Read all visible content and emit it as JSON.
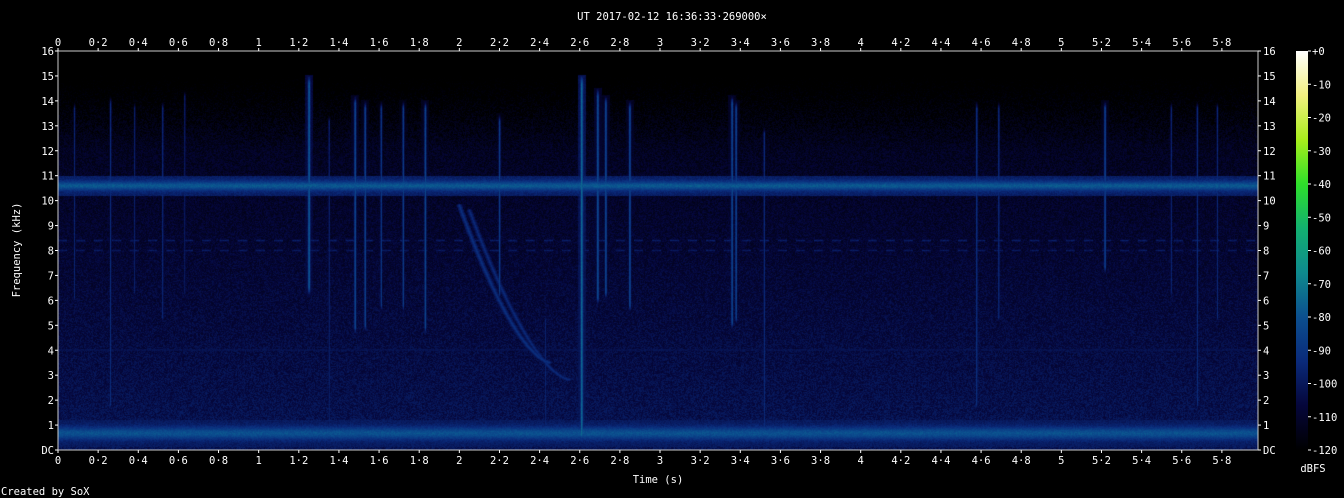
{
  "chart_data": {
    "type": "heatmap",
    "title": "UT 2017-02-12 16:36:33·269000×",
    "xlabel": "Time (s)",
    "ylabel": "Frequency (kHz)",
    "footer": "Created by SoX",
    "xlim": [
      0,
      5.98
    ],
    "ylim": [
      0,
      16
    ],
    "x_ticks": [
      "0",
      "0·2",
      "0·4",
      "0·6",
      "0·8",
      "1",
      "1·2",
      "1·4",
      "1·6",
      "1·8",
      "2",
      "2·2",
      "2·4",
      "2·6",
      "2·8",
      "3",
      "3·2",
      "3·4",
      "3·6",
      "3·8",
      "4",
      "4·2",
      "4·4",
      "4·6",
      "4·8",
      "5",
      "5·2",
      "5·4",
      "5·6",
      "5·8"
    ],
    "y_ticks": [
      "DC",
      "1",
      "2",
      "3",
      "4",
      "5",
      "6",
      "7",
      "8",
      "9",
      "10",
      "11",
      "12",
      "13",
      "14",
      "15",
      "16"
    ],
    "colorbar": {
      "label": "dBFS",
      "ticks": [
        "+0",
        "-10",
        "-20",
        "-30",
        "-40",
        "-50",
        "-60",
        "-70",
        "-80",
        "-90",
        "-100",
        "-110",
        "-120"
      ],
      "range": [
        -120,
        0
      ],
      "colors": [
        "#000000",
        "#05063a",
        "#0a2a7a",
        "#0b4f8f",
        "#0e8a8e",
        "#12b070",
        "#2ee02a",
        "#a8ee1c",
        "#f2f080",
        "#ffffff"
      ]
    },
    "background_level_dbfs": -105,
    "bands": [
      {
        "name": "tone",
        "freq_khz": 10.6,
        "width_khz": 0.35,
        "level_dbfs": -78
      },
      {
        "name": "low-band",
        "freq_khz": 0.65,
        "width_khz": 0.5,
        "level_dbfs": -80
      },
      {
        "name": "dashed",
        "freq_khz": 8.4,
        "width_khz": 0.12,
        "level_dbfs": -98
      },
      {
        "name": "dashed",
        "freq_khz": 8.0,
        "width_khz": 0.12,
        "level_dbfs": -99
      },
      {
        "name": "hum",
        "freq_khz": 4.0,
        "width_khz": 0.1,
        "level_dbfs": -100
      }
    ],
    "impulses": [
      {
        "t": 0.08,
        "f_min": 5.8,
        "f_max": 14.0,
        "level_dbfs": -95
      },
      {
        "t": 0.26,
        "f_min": 1.5,
        "f_max": 14.2,
        "level_dbfs": -92
      },
      {
        "t": 0.38,
        "f_min": 6.0,
        "f_max": 14.0,
        "level_dbfs": -96
      },
      {
        "t": 0.52,
        "f_min": 5.0,
        "f_max": 14.0,
        "level_dbfs": -93
      },
      {
        "t": 0.63,
        "f_min": 6.0,
        "f_max": 14.5,
        "level_dbfs": -97
      },
      {
        "t": 1.25,
        "f_min": 6.2,
        "f_max": 15.0,
        "level_dbfs": -76
      },
      {
        "t": 1.35,
        "f_min": 0.5,
        "f_max": 13.5,
        "level_dbfs": -95
      },
      {
        "t": 1.48,
        "f_min": 4.6,
        "f_max": 14.2,
        "level_dbfs": -82
      },
      {
        "t": 1.53,
        "f_min": 4.7,
        "f_max": 14.0,
        "level_dbfs": -84
      },
      {
        "t": 1.61,
        "f_min": 5.5,
        "f_max": 14.0,
        "level_dbfs": -88
      },
      {
        "t": 1.72,
        "f_min": 5.5,
        "f_max": 14.0,
        "level_dbfs": -86
      },
      {
        "t": 1.83,
        "f_min": 4.6,
        "f_max": 14.0,
        "level_dbfs": -83
      },
      {
        "t": 2.2,
        "f_min": 6.0,
        "f_max": 13.5,
        "level_dbfs": -86
      },
      {
        "t": 2.43,
        "f_min": 0.5,
        "f_max": 5.5,
        "level_dbfs": -95
      },
      {
        "t": 2.61,
        "f_min": 0.3,
        "f_max": 15.0,
        "level_dbfs": -72
      },
      {
        "t": 2.69,
        "f_min": 5.8,
        "f_max": 14.5,
        "level_dbfs": -80
      },
      {
        "t": 2.73,
        "f_min": 6.0,
        "f_max": 14.2,
        "level_dbfs": -82
      },
      {
        "t": 2.85,
        "f_min": 5.5,
        "f_max": 14.0,
        "level_dbfs": -82
      },
      {
        "t": 3.36,
        "f_min": 4.8,
        "f_max": 14.2,
        "level_dbfs": -82
      },
      {
        "t": 3.38,
        "f_min": 5.0,
        "f_max": 14.0,
        "level_dbfs": -84
      },
      {
        "t": 3.52,
        "f_min": 0.5,
        "f_max": 13.0,
        "level_dbfs": -92
      },
      {
        "t": 4.58,
        "f_min": 1.5,
        "f_max": 14.0,
        "level_dbfs": -90
      },
      {
        "t": 4.69,
        "f_min": 5.0,
        "f_max": 14.0,
        "level_dbfs": -92
      },
      {
        "t": 5.22,
        "f_min": 7.0,
        "f_max": 14.0,
        "level_dbfs": -84
      },
      {
        "t": 5.55,
        "f_min": 6.0,
        "f_max": 14.0,
        "level_dbfs": -94
      },
      {
        "t": 5.68,
        "f_min": 1.5,
        "f_max": 14.0,
        "level_dbfs": -92
      },
      {
        "t": 5.78,
        "f_min": 5.0,
        "f_max": 14.0,
        "level_dbfs": -94
      }
    ],
    "sweeps": [
      {
        "t_start": 2.0,
        "f_start": 9.8,
        "t_end": 2.45,
        "f_end": 3.5,
        "level_dbfs": -92
      },
      {
        "t_start": 2.05,
        "f_start": 9.6,
        "t_end": 2.55,
        "f_end": 2.8,
        "level_dbfs": -94
      }
    ]
  }
}
